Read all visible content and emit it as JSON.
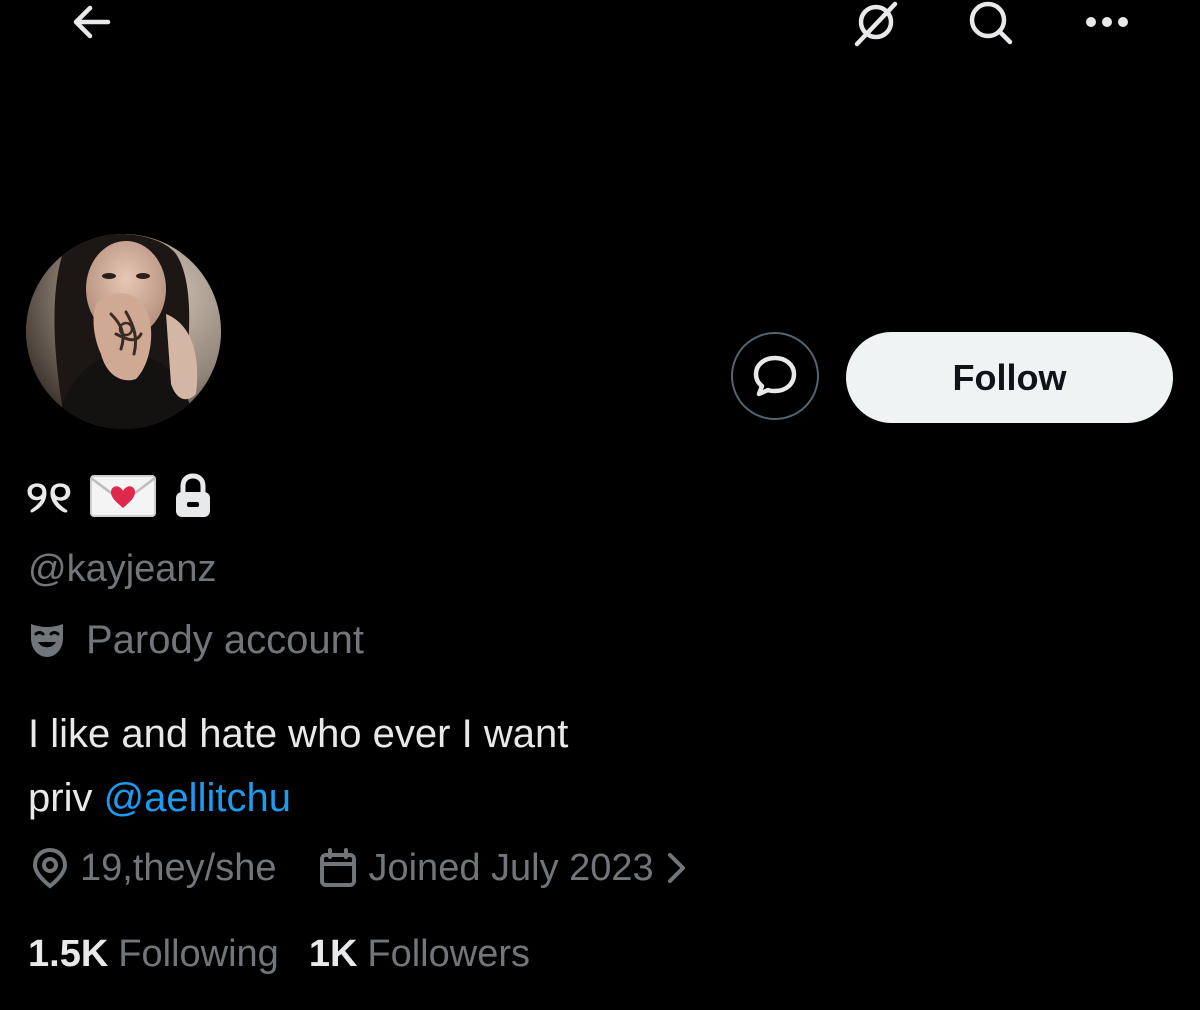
{
  "profile": {
    "display_name": "୨୧",
    "handle": "@kayjeanz",
    "parody_label": "Parody account",
    "bio_line1": "I like and hate who ever I want",
    "bio_line2_prefix": "priv ",
    "bio_mention": "@aellitchu",
    "location": "19,they/she",
    "joined": "Joined July 2023",
    "following_count": "1.5K",
    "following_label": "Following",
    "followers_count": "1K",
    "followers_label": "Followers"
  },
  "actions": {
    "follow_label": "Follow"
  },
  "icons": {
    "back": "back-arrow-icon",
    "grok": "grok-icon",
    "search": "search-icon",
    "more": "more-icon",
    "message": "message-icon",
    "lock": "lock-icon",
    "parody": "parody-mask-icon",
    "location": "location-pin-icon",
    "calendar": "calendar-icon",
    "chevron": "chevron-right-icon"
  },
  "colors": {
    "background": "#000000",
    "text_primary": "#e7e9ea",
    "text_secondary": "#71767b",
    "link": "#1d9bf0",
    "follow_bg": "#eff3f4"
  }
}
